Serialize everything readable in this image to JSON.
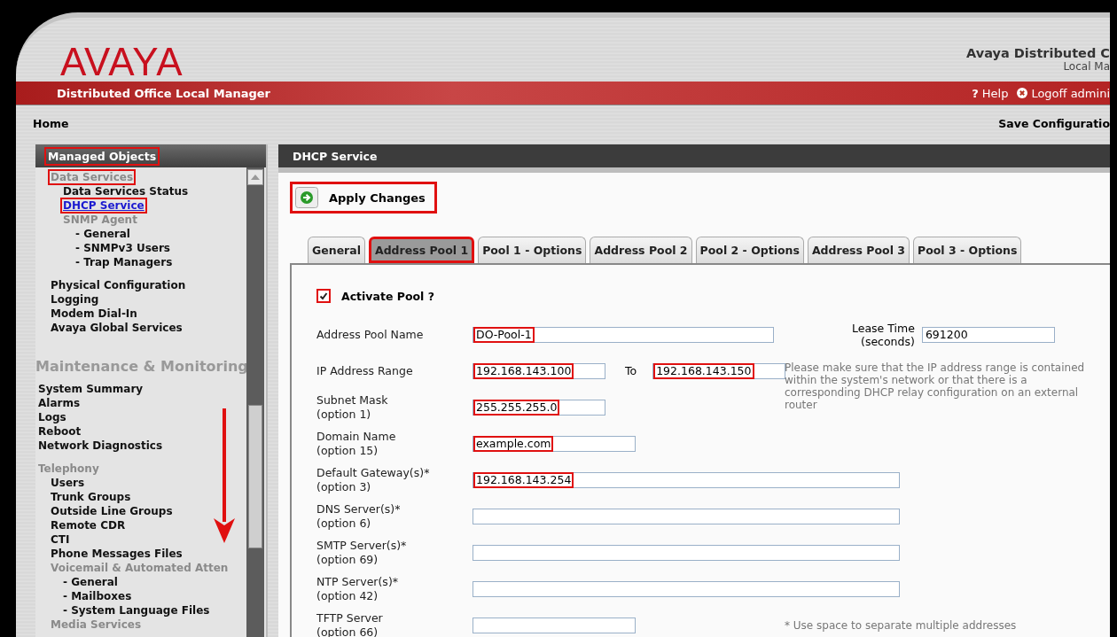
{
  "header": {
    "logo": "AVAYA",
    "product_title": "Avaya Distributed C",
    "product_subtitle": "Local Ma"
  },
  "banner": {
    "title": "Distributed Office Local Manager",
    "help_icon": "?",
    "help": "Help",
    "logoff": "Logoff admini"
  },
  "toolbar": {
    "breadcrumb": "Home",
    "save_link": "Save Configuratio"
  },
  "sidebar": {
    "header": {
      "label": "Managed Objects",
      "highlighted": true
    },
    "items": [
      {
        "label": "Data Services",
        "kind": "group",
        "selected": false,
        "highlighted": true,
        "children": [
          {
            "label": "Data Services Status",
            "kind": "link",
            "selected": false,
            "highlighted": false
          },
          {
            "label": "DHCP Service",
            "kind": "link",
            "selected": true,
            "highlighted": true
          },
          {
            "label": "SNMP Agent",
            "kind": "group",
            "selected": false,
            "highlighted": false,
            "children": [
              {
                "label": "- General",
                "kind": "link",
                "selected": false,
                "highlighted": false
              },
              {
                "label": "- SNMPv3 Users",
                "kind": "link",
                "selected": false,
                "highlighted": false
              },
              {
                "label": "- Trap Managers",
                "kind": "link",
                "selected": false,
                "highlighted": false
              }
            ]
          }
        ]
      },
      {
        "label": "Physical Configuration",
        "kind": "link",
        "selected": false,
        "highlighted": false
      },
      {
        "label": "Logging",
        "kind": "link",
        "selected": false,
        "highlighted": false
      },
      {
        "label": "Modem Dial-In",
        "kind": "link",
        "selected": false,
        "highlighted": false
      },
      {
        "label": "Avaya Global Services",
        "kind": "link",
        "selected": false,
        "highlighted": false
      }
    ],
    "sections": [
      {
        "title": "Maintenance & Monitoring",
        "items": [
          {
            "label": "System Summary",
            "kind": "link",
            "selected": false,
            "highlighted": false
          },
          {
            "label": "Alarms",
            "kind": "link",
            "selected": false,
            "highlighted": false
          },
          {
            "label": "Logs",
            "kind": "link",
            "selected": false,
            "highlighted": false
          },
          {
            "label": "Reboot",
            "kind": "link",
            "selected": false,
            "highlighted": false
          },
          {
            "label": "Network Diagnostics",
            "kind": "link",
            "selected": false,
            "highlighted": false
          },
          {
            "label": "Telephony",
            "kind": "group",
            "selected": false,
            "highlighted": false,
            "children": [
              {
                "label": "Users",
                "kind": "link",
                "selected": false,
                "highlighted": false
              },
              {
                "label": "Trunk Groups",
                "kind": "link",
                "selected": false,
                "highlighted": false
              },
              {
                "label": "Outside Line Groups",
                "kind": "link",
                "selected": false,
                "highlighted": false
              },
              {
                "label": "Remote CDR",
                "kind": "link",
                "selected": false,
                "highlighted": false
              },
              {
                "label": "CTI",
                "kind": "link",
                "selected": false,
                "highlighted": false
              },
              {
                "label": "Phone Messages Files",
                "kind": "link",
                "selected": false,
                "highlighted": false
              },
              {
                "label": "Voicemail & Automated Atten",
                "kind": "group",
                "selected": false,
                "highlighted": false,
                "children": [
                  {
                    "label": "- General",
                    "kind": "link",
                    "selected": false,
                    "highlighted": false
                  },
                  {
                    "label": "- Mailboxes",
                    "kind": "link",
                    "selected": false,
                    "highlighted": false
                  },
                  {
                    "label": "- System Language Files",
                    "kind": "link",
                    "selected": false,
                    "highlighted": false
                  }
                ]
              },
              {
                "label": "Media Services",
                "kind": "group",
                "selected": false,
                "highlighted": false
              }
            ]
          }
        ]
      }
    ]
  },
  "panel": {
    "title": "DHCP Service",
    "apply_button": {
      "label": "Apply Changes",
      "highlighted": true
    },
    "tabs": [
      {
        "label": "General",
        "selected": false,
        "highlighted": false
      },
      {
        "label": "Address Pool 1",
        "selected": true,
        "highlighted": true
      },
      {
        "label": "Pool 1 - Options",
        "selected": false,
        "highlighted": false
      },
      {
        "label": "Address Pool 2",
        "selected": false,
        "highlighted": false
      },
      {
        "label": "Pool 2 - Options",
        "selected": false,
        "highlighted": false
      },
      {
        "label": "Address Pool 3",
        "selected": false,
        "highlighted": false
      },
      {
        "label": "Pool 3 - Options",
        "selected": false,
        "highlighted": false
      }
    ],
    "activate": {
      "label": "Activate Pool ?",
      "checked": true,
      "highlighted": true
    },
    "rows": [
      {
        "label": "Address Pool Name",
        "fields": [
          {
            "kind": "name",
            "value": "DO-Pool-1",
            "highlighted": true
          }
        ],
        "side": {
          "label": "Lease Time",
          "option": "(seconds)",
          "field": {
            "kind": "ip",
            "value": "691200",
            "highlighted": false
          }
        }
      },
      {
        "label": "IP Address Range",
        "fields": [
          {
            "kind": "ip",
            "value": "192.168.143.100",
            "highlighted": true
          },
          {
            "kind": "ip",
            "value": "192.168.143.150",
            "highlighted": true
          }
        ],
        "joiner": "To",
        "note": "Please make sure that the IP address range is contained within the system's network or that there is a corresponding DHCP relay configuration on an external router"
      },
      {
        "label": "Subnet Mask",
        "option": "(option 1)",
        "fields": [
          {
            "kind": "ip",
            "value": "255.255.255.0",
            "highlighted": true
          }
        ]
      },
      {
        "label": "Domain Name",
        "option": "(option 15)",
        "fields": [
          {
            "kind": "domain",
            "value": "example.com",
            "highlighted": true
          }
        ]
      },
      {
        "label": "Default Gateway(s)*",
        "option": "(option 3)",
        "fields": [
          {
            "kind": "list",
            "value": "192.168.143.254",
            "highlighted": true
          }
        ]
      },
      {
        "label": "DNS Server(s)*",
        "option": "(option 6)",
        "fields": [
          {
            "kind": "list"
          }
        ]
      },
      {
        "label": "SMTP Server(s)*",
        "option": "(option 69)",
        "fields": [
          {
            "kind": "list"
          }
        ]
      },
      {
        "label": "NTP Server(s)*",
        "option": "(option 42)",
        "fields": [
          {
            "kind": "list"
          }
        ]
      },
      {
        "label": "TFTP Server",
        "option": "(option 66)",
        "fields": [
          {
            "kind": "domain"
          }
        ],
        "note": "* Use space to separate multiple addresses"
      }
    ]
  }
}
